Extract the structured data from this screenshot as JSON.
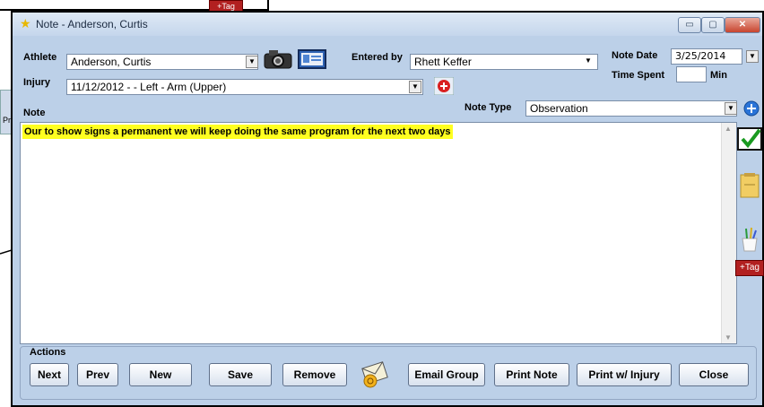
{
  "window": {
    "title": "Note - Anderson, Curtis",
    "controls": {
      "minimize": "▭",
      "maximize": "▢",
      "close": "✕"
    }
  },
  "background": {
    "tag_label": "+Tag",
    "side_label": "Pr"
  },
  "athlete": {
    "label": "Athlete",
    "value": "Anderson, Curtis"
  },
  "entered_by": {
    "label": "Entered by",
    "value": "Rhett Keffer"
  },
  "note_date": {
    "label": "Note Date",
    "value": "3/25/2014"
  },
  "time_spent": {
    "label": "Time Spent",
    "value": "",
    "unit": "Min"
  },
  "injury": {
    "label": "Injury",
    "value": "11/12/2012 -  - Left - Arm (Upper)"
  },
  "note_type": {
    "label": "Note Type",
    "value": "Observation"
  },
  "note": {
    "label": "Note",
    "text": "Our to show signs a permanent we will keep doing the same program for the next two days"
  },
  "side_tools": {
    "tag_label": "+Tag"
  },
  "actions": {
    "title": "Actions",
    "buttons": [
      "Next",
      "Prev",
      "New",
      "Save",
      "Remove",
      "Email Group",
      "Print Note",
      "Print w/ Injury",
      "Close"
    ]
  },
  "colors": {
    "highlight": "#ffff20",
    "window_bg": "#bcd0e8",
    "tag_red": "#b22020",
    "add_red": "#d92020",
    "add_blue": "#2a74d8"
  }
}
